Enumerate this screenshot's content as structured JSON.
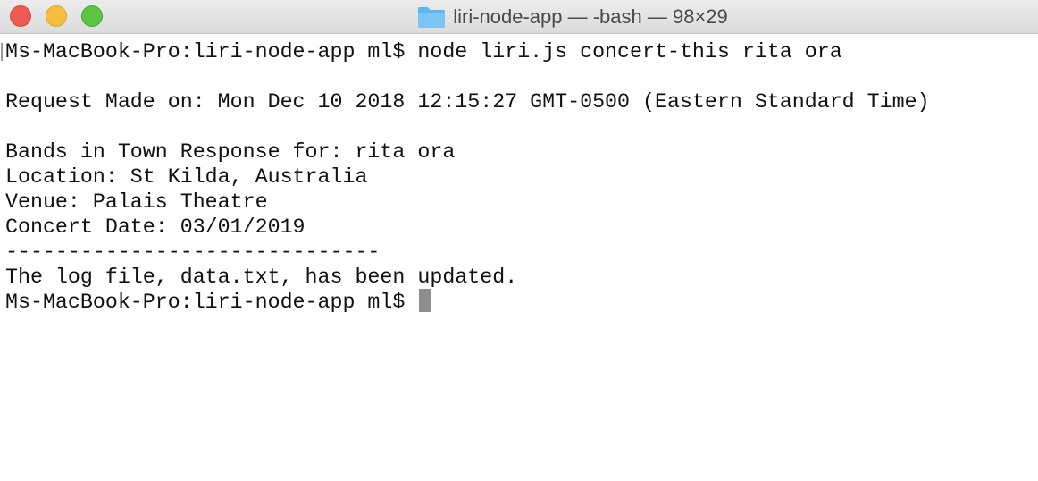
{
  "window": {
    "title": "liri-node-app — -bash — 98×29",
    "icon": "folder-icon",
    "controls": [
      "close",
      "minimize",
      "zoom"
    ]
  },
  "terminal": {
    "lines": [
      "Ms-MacBook-Pro:liri-node-app ml$ node liri.js concert-this rita ora",
      "",
      "Request Made on: Mon Dec 10 2018 12:15:27 GMT-0500 (Eastern Standard Time)",
      "",
      "Bands in Town Response for: rita ora",
      "Location: St Kilda, Australia",
      "Venue: Palais Theatre",
      "Concert Date: 03/01/2019",
      "------------------------------",
      "The log file, data.txt, has been updated."
    ],
    "prompt": "Ms-MacBook-Pro:liri-node-app ml$ "
  },
  "colors": {
    "close": "#ee5b53",
    "minimize": "#f6be3c",
    "zoom": "#5dc442",
    "folder": "#5fb6ef",
    "cursor": "#8e8e8e"
  }
}
